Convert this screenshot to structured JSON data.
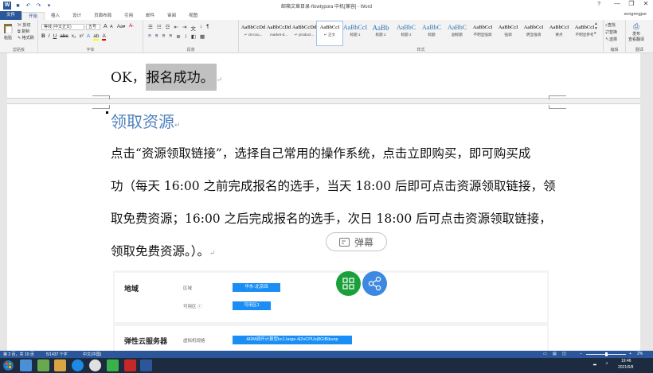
{
  "window": {
    "title": "邮箱文章目录-flowtypora 中机[兼容] - Word",
    "help": "?",
    "user": "songengjue",
    "controls": [
      "—",
      "❐",
      "✕"
    ]
  },
  "tabs": [
    "文件",
    "开始",
    "插入",
    "设计",
    "页面布局",
    "引用",
    "邮件",
    "审阅",
    "视图"
  ],
  "active_tab": "开始",
  "ribbon": {
    "clipboard": {
      "paste": "粘贴",
      "cut": "剪切",
      "copy": "复制",
      "painter": "格式刷",
      "label": "剪贴板"
    },
    "font": {
      "name": "等线 (中文正文)",
      "size": "五号",
      "grow": "A",
      "shrink": "A",
      "label": "字体"
    },
    "paragraph": {
      "label": "段落"
    },
    "styles": {
      "label": "样式",
      "items": [
        {
          "preview": "AaBbCcDd",
          "name": "↵ ctt-cou..."
        },
        {
          "preview": "AaBbCcDd",
          "name": "market-d..."
        },
        {
          "preview": "AaBbCcDd",
          "name": "↵ product..."
        },
        {
          "preview": "AaBbCcI",
          "name": "↵ 正文"
        },
        {
          "preview": "AaBbCcI",
          "name": "标题 1"
        },
        {
          "preview": "AaBb",
          "name": "标题 2"
        },
        {
          "preview": "AaBbC",
          "name": "标题 2"
        },
        {
          "preview": "AaBbC",
          "name": "标题"
        },
        {
          "preview": "AaBbC",
          "name": "副标题"
        },
        {
          "preview": "AaBbCcI",
          "name": "不明显强调"
        },
        {
          "preview": "AaBbCcI",
          "name": "强调"
        },
        {
          "preview": "AaBbCcI",
          "name": "明显强调"
        },
        {
          "preview": "AaBbCcI",
          "name": "要点"
        },
        {
          "preview": "AaBbCcI",
          "name": "不明显参考"
        }
      ],
      "selected_index": 3
    },
    "editing": {
      "find": "查找",
      "replace": "替换",
      "select": "选择",
      "label": "编辑"
    },
    "review": {
      "line1": "发布",
      "line2": "查看翻译",
      "label": "翻译"
    }
  },
  "document": {
    "ok_prefix": "OK，",
    "ok_highlight": "报名成功。",
    "heading": "领取资源",
    "para1_line1": "点击“资源领取链接”，选择自己常用的操作系统，点击立即购买，即可购买成",
    "para1_line2": "功（每天 16:00 之前完成报名的选手，当天 18:00 后即可点击资源领取链接，领",
    "para1_line3": "取免费资源；16:00 之后完成报名的选手，次日 18:00 后可点击资源领取链接，",
    "para1_line4": "领取免费资源。）。",
    "danmaku": "弹幕"
  },
  "console": {
    "region_title": "地域",
    "region_label": "区域",
    "region_value": "华东-北京四",
    "az_label": "可用区",
    "az_value": "可用区1",
    "ecs_title": "弹性云服务器",
    "spec_label": "虚拟机规格",
    "spec_value": "ARM调开计算型kc1.large.4|2vCPUs|8GiB|kunp"
  },
  "status": {
    "page": "第 2 页，共 10 页",
    "words": "5/1437 个字",
    "lang": "中文(中国)",
    "zoom": "2%"
  },
  "taskbar": {
    "time": "19:46",
    "date": "2021/6/8"
  },
  "ime": {
    "logo": "S",
    "mode": "中"
  }
}
